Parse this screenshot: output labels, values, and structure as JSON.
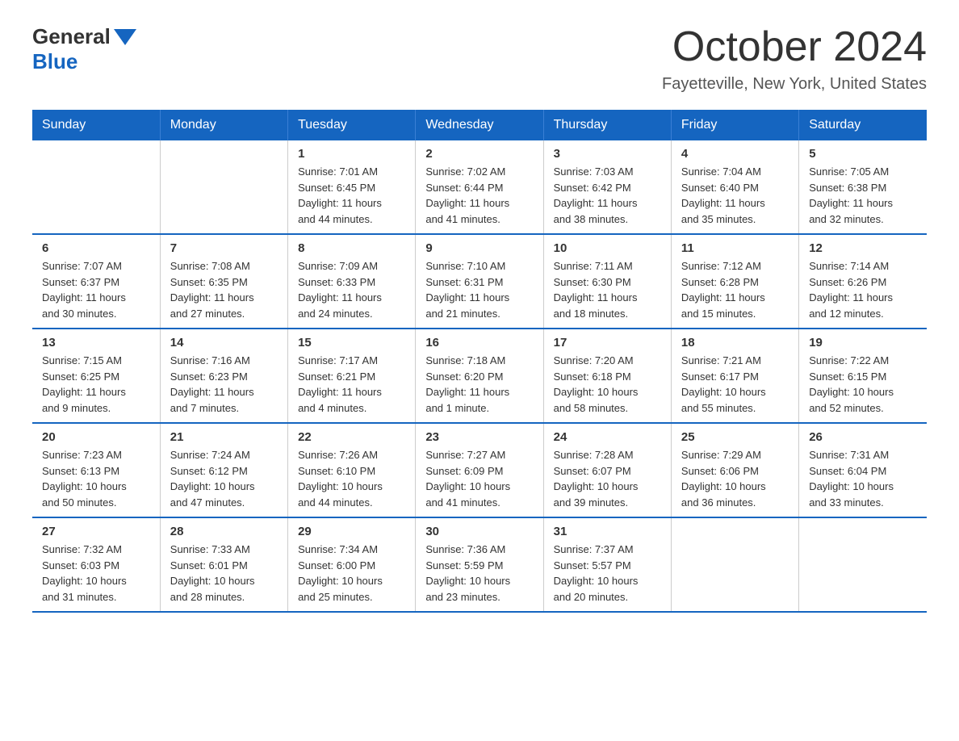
{
  "logo": {
    "general": "General",
    "blue": "Blue"
  },
  "title": "October 2024",
  "subtitle": "Fayetteville, New York, United States",
  "days_of_week": [
    "Sunday",
    "Monday",
    "Tuesday",
    "Wednesday",
    "Thursday",
    "Friday",
    "Saturday"
  ],
  "weeks": [
    [
      {
        "day": "",
        "info": ""
      },
      {
        "day": "",
        "info": ""
      },
      {
        "day": "1",
        "info": "Sunrise: 7:01 AM\nSunset: 6:45 PM\nDaylight: 11 hours\nand 44 minutes."
      },
      {
        "day": "2",
        "info": "Sunrise: 7:02 AM\nSunset: 6:44 PM\nDaylight: 11 hours\nand 41 minutes."
      },
      {
        "day": "3",
        "info": "Sunrise: 7:03 AM\nSunset: 6:42 PM\nDaylight: 11 hours\nand 38 minutes."
      },
      {
        "day": "4",
        "info": "Sunrise: 7:04 AM\nSunset: 6:40 PM\nDaylight: 11 hours\nand 35 minutes."
      },
      {
        "day": "5",
        "info": "Sunrise: 7:05 AM\nSunset: 6:38 PM\nDaylight: 11 hours\nand 32 minutes."
      }
    ],
    [
      {
        "day": "6",
        "info": "Sunrise: 7:07 AM\nSunset: 6:37 PM\nDaylight: 11 hours\nand 30 minutes."
      },
      {
        "day": "7",
        "info": "Sunrise: 7:08 AM\nSunset: 6:35 PM\nDaylight: 11 hours\nand 27 minutes."
      },
      {
        "day": "8",
        "info": "Sunrise: 7:09 AM\nSunset: 6:33 PM\nDaylight: 11 hours\nand 24 minutes."
      },
      {
        "day": "9",
        "info": "Sunrise: 7:10 AM\nSunset: 6:31 PM\nDaylight: 11 hours\nand 21 minutes."
      },
      {
        "day": "10",
        "info": "Sunrise: 7:11 AM\nSunset: 6:30 PM\nDaylight: 11 hours\nand 18 minutes."
      },
      {
        "day": "11",
        "info": "Sunrise: 7:12 AM\nSunset: 6:28 PM\nDaylight: 11 hours\nand 15 minutes."
      },
      {
        "day": "12",
        "info": "Sunrise: 7:14 AM\nSunset: 6:26 PM\nDaylight: 11 hours\nand 12 minutes."
      }
    ],
    [
      {
        "day": "13",
        "info": "Sunrise: 7:15 AM\nSunset: 6:25 PM\nDaylight: 11 hours\nand 9 minutes."
      },
      {
        "day": "14",
        "info": "Sunrise: 7:16 AM\nSunset: 6:23 PM\nDaylight: 11 hours\nand 7 minutes."
      },
      {
        "day": "15",
        "info": "Sunrise: 7:17 AM\nSunset: 6:21 PM\nDaylight: 11 hours\nand 4 minutes."
      },
      {
        "day": "16",
        "info": "Sunrise: 7:18 AM\nSunset: 6:20 PM\nDaylight: 11 hours\nand 1 minute."
      },
      {
        "day": "17",
        "info": "Sunrise: 7:20 AM\nSunset: 6:18 PM\nDaylight: 10 hours\nand 58 minutes."
      },
      {
        "day": "18",
        "info": "Sunrise: 7:21 AM\nSunset: 6:17 PM\nDaylight: 10 hours\nand 55 minutes."
      },
      {
        "day": "19",
        "info": "Sunrise: 7:22 AM\nSunset: 6:15 PM\nDaylight: 10 hours\nand 52 minutes."
      }
    ],
    [
      {
        "day": "20",
        "info": "Sunrise: 7:23 AM\nSunset: 6:13 PM\nDaylight: 10 hours\nand 50 minutes."
      },
      {
        "day": "21",
        "info": "Sunrise: 7:24 AM\nSunset: 6:12 PM\nDaylight: 10 hours\nand 47 minutes."
      },
      {
        "day": "22",
        "info": "Sunrise: 7:26 AM\nSunset: 6:10 PM\nDaylight: 10 hours\nand 44 minutes."
      },
      {
        "day": "23",
        "info": "Sunrise: 7:27 AM\nSunset: 6:09 PM\nDaylight: 10 hours\nand 41 minutes."
      },
      {
        "day": "24",
        "info": "Sunrise: 7:28 AM\nSunset: 6:07 PM\nDaylight: 10 hours\nand 39 minutes."
      },
      {
        "day": "25",
        "info": "Sunrise: 7:29 AM\nSunset: 6:06 PM\nDaylight: 10 hours\nand 36 minutes."
      },
      {
        "day": "26",
        "info": "Sunrise: 7:31 AM\nSunset: 6:04 PM\nDaylight: 10 hours\nand 33 minutes."
      }
    ],
    [
      {
        "day": "27",
        "info": "Sunrise: 7:32 AM\nSunset: 6:03 PM\nDaylight: 10 hours\nand 31 minutes."
      },
      {
        "day": "28",
        "info": "Sunrise: 7:33 AM\nSunset: 6:01 PM\nDaylight: 10 hours\nand 28 minutes."
      },
      {
        "day": "29",
        "info": "Sunrise: 7:34 AM\nSunset: 6:00 PM\nDaylight: 10 hours\nand 25 minutes."
      },
      {
        "day": "30",
        "info": "Sunrise: 7:36 AM\nSunset: 5:59 PM\nDaylight: 10 hours\nand 23 minutes."
      },
      {
        "day": "31",
        "info": "Sunrise: 7:37 AM\nSunset: 5:57 PM\nDaylight: 10 hours\nand 20 minutes."
      },
      {
        "day": "",
        "info": ""
      },
      {
        "day": "",
        "info": ""
      }
    ]
  ]
}
